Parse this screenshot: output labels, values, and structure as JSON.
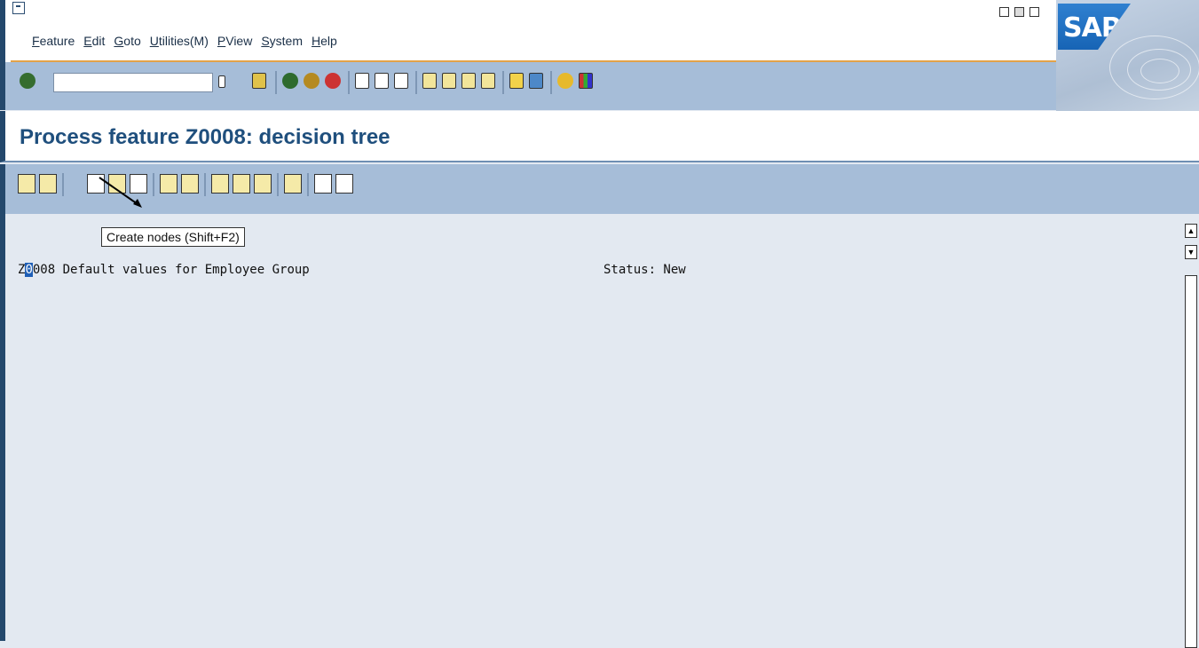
{
  "menubar": {
    "items": [
      "Feature",
      "Edit",
      "Goto",
      "Utilities(M)",
      "PView",
      "System",
      "Help"
    ]
  },
  "toolbar1": {
    "command_field": {
      "value": "",
      "placeholder": ""
    },
    "icons": [
      "enter-icon",
      "save-icon",
      "back-icon",
      "exit-icon",
      "cancel-icon",
      "print-icon",
      "find-icon",
      "find-next-icon",
      "first-page-icon",
      "previous-page-icon",
      "next-page-icon",
      "last-page-icon",
      "create-session-icon",
      "shortcut-icon",
      "help-icon",
      "layout-icon"
    ]
  },
  "title": "Process feature Z0008: decision tree",
  "toolbar2": {
    "icons": [
      "check-icon",
      "display-icon",
      "create-node-icon",
      "change-icon",
      "delete-icon",
      "move-icon",
      "info-icon",
      "cut-icon",
      "copy-icon",
      "paste-icon",
      "doc-icon",
      "expand-icon",
      "collapse-icon"
    ]
  },
  "tooltip": "Create nodes  (Shift+F2)",
  "tree": {
    "line_prefix": "Z",
    "line_cursor": "0",
    "line_rest": "008 Default values for Employee Group",
    "status": "Status: New"
  },
  "colors": {
    "frame": "#24486c",
    "toolbar": "#a6bdd8",
    "content": "#e3e9f1",
    "title": "#1f4f7d",
    "accent": "#e2a24a"
  }
}
